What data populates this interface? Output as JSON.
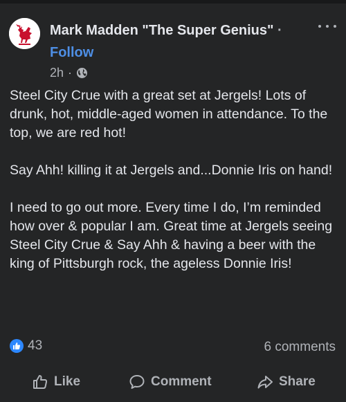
{
  "post": {
    "author": "Mark Madden \"The Super Genius\"",
    "separator": "·",
    "follow_label": "Follow",
    "timestamp": "2h",
    "meta_separator": "·",
    "audience_icon": "globe-icon",
    "paragraphs": [
      "Steel City Crue with a great set at Jergels! Lots of drunk, hot, middle-aged women in attendance. To the top, we are red hot!",
      "Say Ahh! killing it at Jergels and...Donnie Iris on hand!",
      "I need to go out more. Every time I do, I’m reminded how over & popular I am. Great time at Jergels seeing Steel City Crue & Say Ahh & having a beer with the king of Pittsburgh rock, the ageless Donnie Iris!"
    ]
  },
  "engagement": {
    "reaction_icon": "like-reaction-icon",
    "reaction_count": "43",
    "comments_count": "6 comments"
  },
  "actions": {
    "like_label": "Like",
    "comment_label": "Comment",
    "share_label": "Share"
  },
  "colors": {
    "background": "#242526",
    "text": "#e4e6eb",
    "secondary": "#b0b3b8",
    "link": "#4e8fe6",
    "avatar_crest": "#c8102e"
  }
}
